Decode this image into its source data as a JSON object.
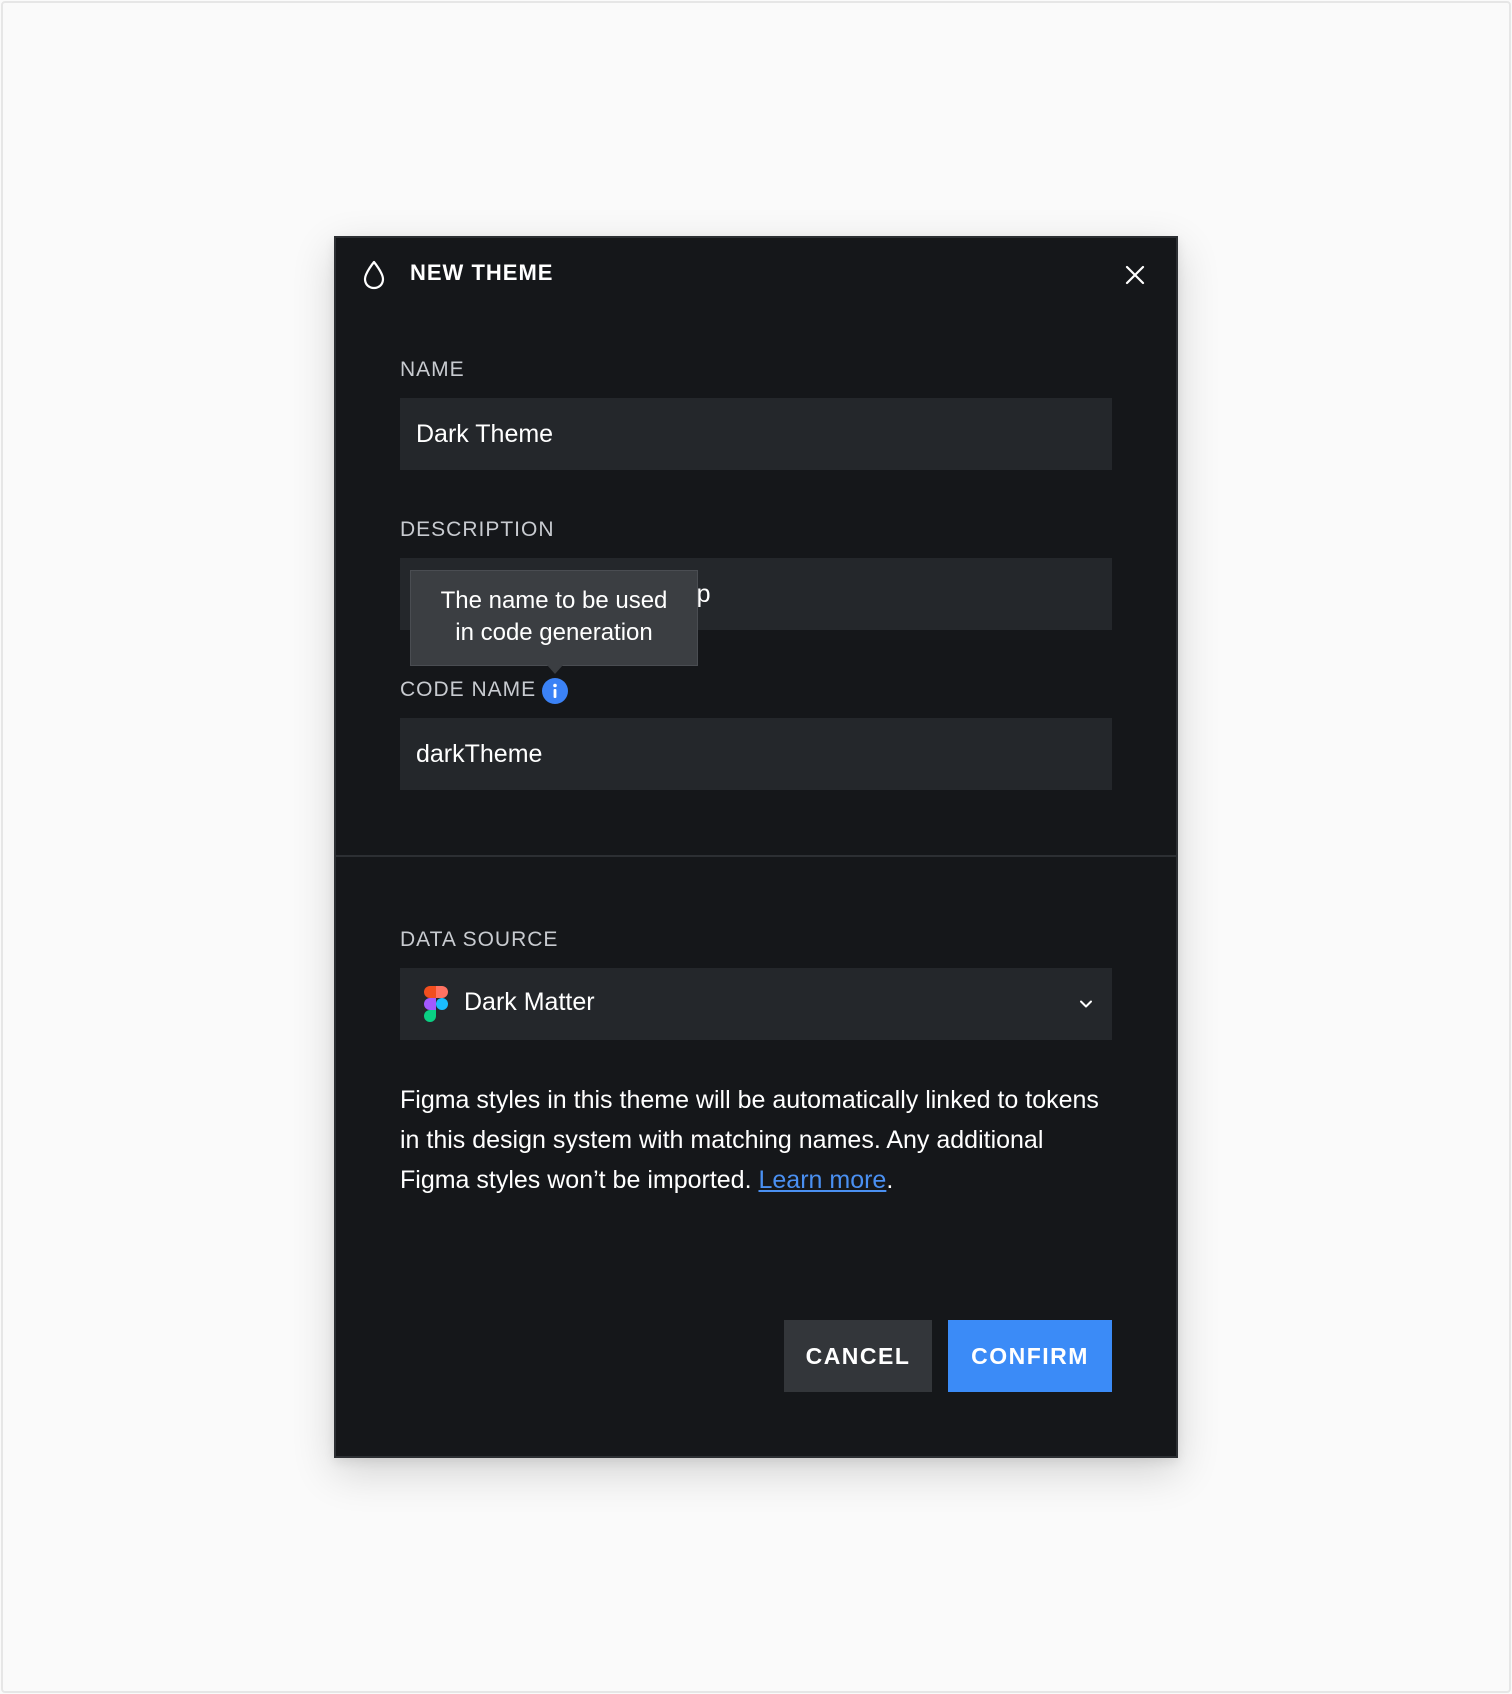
{
  "dialog": {
    "title": "NEW THEME",
    "icon": "drop-icon",
    "close_icon": "close-icon"
  },
  "form": {
    "name": {
      "label": "NAME",
      "value": "Dark Theme"
    },
    "description": {
      "label": "DESCRIPTION",
      "value": "Dark theme for mobile app"
    },
    "code_name": {
      "label": "CODE NAME",
      "value": "darkTheme",
      "info_icon": "info-icon",
      "tooltip_line1": "The name to be used",
      "tooltip_line2": "in code generation"
    }
  },
  "data_source": {
    "label": "DATA SOURCE",
    "selected": "Dark Matter",
    "icon": "figma-icon"
  },
  "help": {
    "text": "Figma styles in this theme will be automatically linked to tokens in this design system with matching names. Any additional Figma styles won’t be imported. ",
    "link": "Learn more",
    "trailing": "."
  },
  "buttons": {
    "cancel": "CANCEL",
    "confirm": "CONFIRM"
  },
  "colors": {
    "dialog_bg": "#15171a",
    "field_bg": "#24272b",
    "accent": "#3b8bf7",
    "link": "#4a90f2"
  }
}
